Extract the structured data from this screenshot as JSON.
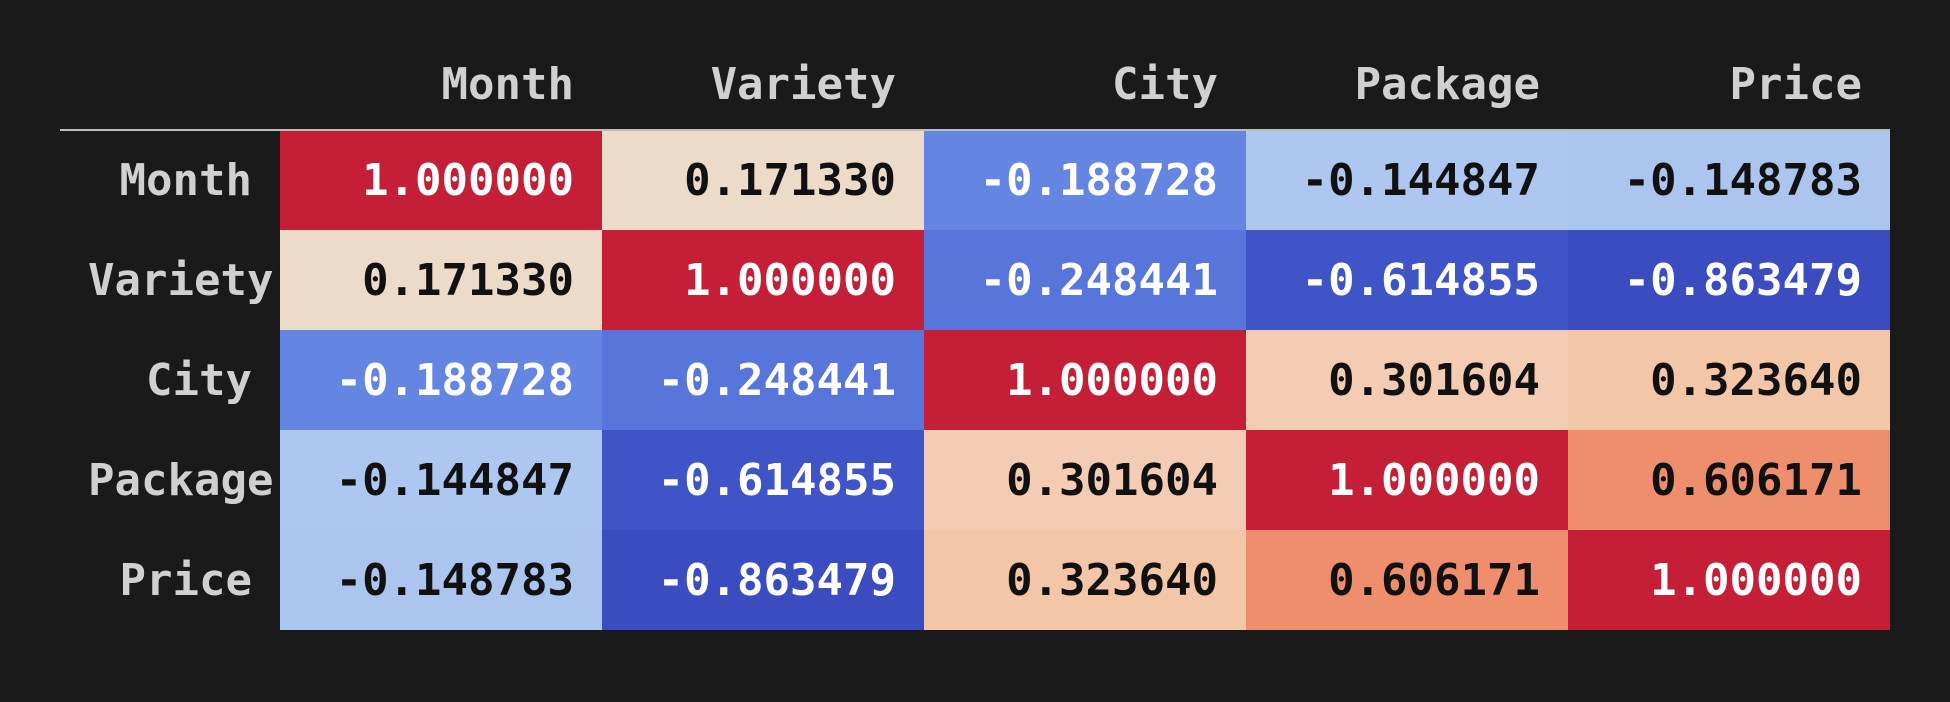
{
  "chart_data": {
    "type": "heatmap",
    "title": "",
    "xlabel": "",
    "ylabel": "",
    "row_labels": [
      "Month",
      "Variety",
      "City",
      "Package",
      "Price"
    ],
    "col_labels": [
      "Month",
      "Variety",
      "City",
      "Package",
      "Price"
    ],
    "values": [
      [
        1.0,
        0.17133,
        -0.188728,
        -0.144847,
        -0.148783
      ],
      [
        0.17133,
        1.0,
        -0.248441,
        -0.614855,
        -0.863479
      ],
      [
        -0.188728,
        -0.248441,
        1.0,
        0.301604,
        0.32364
      ],
      [
        -0.144847,
        -0.614855,
        0.301604,
        1.0,
        0.606171
      ],
      [
        -0.148783,
        -0.863479,
        0.32364,
        0.606171,
        1.0
      ]
    ],
    "display_values": [
      [
        "1.000000",
        "0.171330",
        "-0.188728",
        "-0.144847",
        "-0.148783"
      ],
      [
        "0.171330",
        "1.000000",
        "-0.248441",
        "-0.614855",
        "-0.863479"
      ],
      [
        "-0.188728",
        "-0.248441",
        "1.000000",
        "0.301604",
        "0.323640"
      ],
      [
        "-0.144847",
        "-0.614855",
        "0.301604",
        "1.000000",
        "0.606171"
      ],
      [
        "-0.148783",
        "-0.863479",
        "0.323640",
        "0.606171",
        "1.000000"
      ]
    ],
    "colorscale": "coolwarm",
    "vmin": -1.0,
    "vmax": 1.0
  },
  "cell_colors": [
    [
      "#c41f36",
      "#ecdbc9",
      "#6585e3",
      "#adc7f0",
      "#abc5ef"
    ],
    [
      "#ecdbc9",
      "#c41f36",
      "#5775da",
      "#3e54c7",
      "#3b4cc0"
    ],
    [
      "#6585e3",
      "#5775da",
      "#c41f36",
      "#f4ccb3",
      "#f4c6a8"
    ],
    [
      "#adc7f0",
      "#3e54c7",
      "#f4ccb3",
      "#c41f36",
      "#ef8e6d"
    ],
    [
      "#abc5ef",
      "#3b4cc0",
      "#f4c6a8",
      "#ef8e6d",
      "#c41f36"
    ]
  ],
  "cell_text_colors": [
    [
      "light",
      "dark",
      "light",
      "dark",
      "dark"
    ],
    [
      "dark",
      "light",
      "light",
      "light",
      "light"
    ],
    [
      "light",
      "light",
      "light",
      "dark",
      "dark"
    ],
    [
      "dark",
      "light",
      "dark",
      "light",
      "dark"
    ],
    [
      "dark",
      "light",
      "dark",
      "dark",
      "light"
    ]
  ]
}
